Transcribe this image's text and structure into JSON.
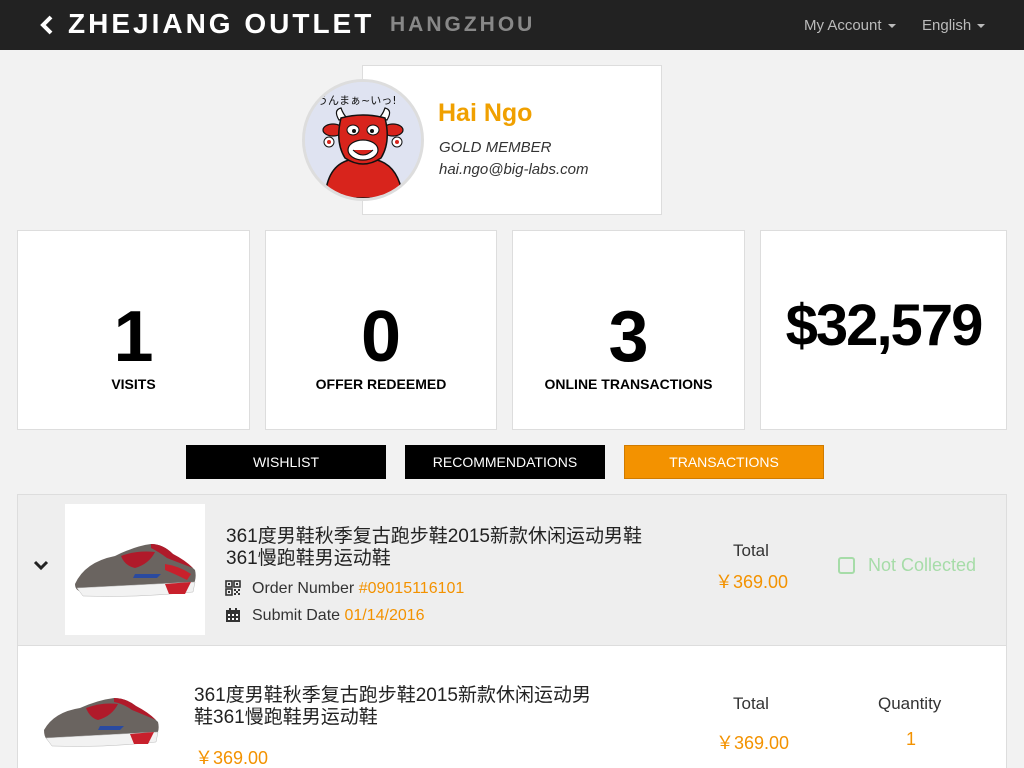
{
  "header": {
    "brand": "ZHEJIANG OUTLET",
    "city": "HANGZHOU",
    "account_menu": "My Account",
    "language_menu": "English"
  },
  "profile": {
    "name": "Hai Ngo",
    "level": "GOLD MEMBER",
    "email": "hai.ngo@big-labs.com",
    "avatar_caption": "うんまぁ~いっ!"
  },
  "stats": [
    {
      "value": "1",
      "label": "VISITS"
    },
    {
      "value": "0",
      "label": "OFFER REDEEMED"
    },
    {
      "value": "3",
      "label": "ONLINE TRANSACTIONS"
    },
    {
      "value": "$32,579",
      "label": ""
    }
  ],
  "tabs": [
    {
      "label": "WISHLIST",
      "active": false
    },
    {
      "label": "RECOMMENDATIONS",
      "active": false
    },
    {
      "label": "TRANSACTIONS",
      "active": true
    }
  ],
  "transaction": {
    "title_line1": "361度男鞋秋季复古跑步鞋2015新款休闲运动男鞋",
    "title_line2": "361慢跑鞋男运动鞋",
    "order_label": "Order Number",
    "order_number": "#09015116101",
    "date_label": "Submit Date",
    "submit_date": "01/14/2016",
    "total_label": "Total",
    "total": "￥369.00",
    "status": "Not Collected"
  },
  "line_item": {
    "title_line1": "361度男鞋秋季复古跑步鞋2015新款休闲运动男",
    "title_line2": "鞋361慢跑鞋男运动鞋",
    "unit_price": "￥369.00",
    "total_label": "Total",
    "total": "￥369.00",
    "quantity_label": "Quantity",
    "quantity": "1"
  },
  "colors": {
    "accent": "#f39200",
    "header_bg": "#222222",
    "status_green": "#a6dca8"
  },
  "icons": {
    "back": "chevron-left-icon",
    "expand": "chevron-down-icon",
    "order": "qr-code-icon",
    "date": "calendar-icon",
    "status": "checkbox-icon"
  }
}
